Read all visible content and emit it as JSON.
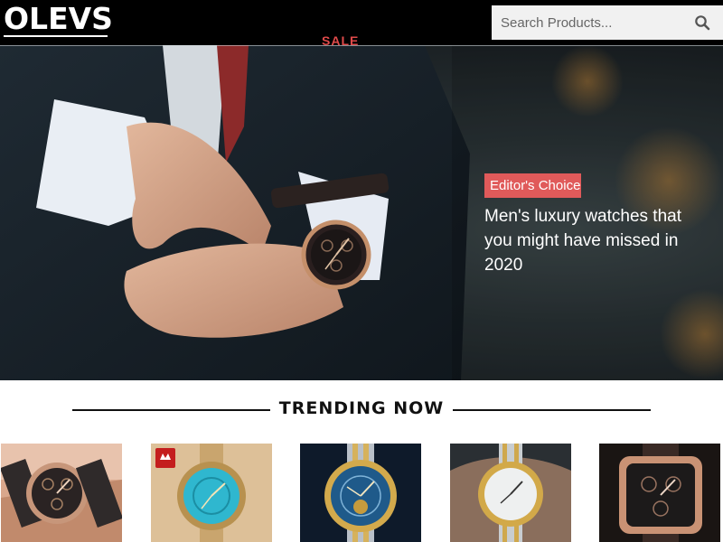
{
  "header": {
    "logo": "OLEVS",
    "search_placeholder": "Search Products...",
    "search_icon": "search-icon",
    "sale_label": "SALE"
  },
  "hero": {
    "badge": "Editor's Choice",
    "headline": "Men's luxury watches that you might have missed in 2020"
  },
  "trending": {
    "title": "TRENDING NOW",
    "products": [
      {
        "image": "watch-on-wrist-rose-gold-chronograph"
      },
      {
        "image": "watch-turquoise-dial-gold-bracelet",
        "brand_tag": "OLEVS"
      },
      {
        "image": "watch-blue-dial-two-tone-bracelet"
      },
      {
        "image": "watch-white-dial-gold-on-wrist"
      },
      {
        "image": "watch-square-rose-gold-case"
      }
    ]
  },
  "colors": {
    "header_bg": "#000000",
    "sale": "#e04a4a",
    "badge": "#e05a5a",
    "search_bg": "#f1f1f1"
  }
}
